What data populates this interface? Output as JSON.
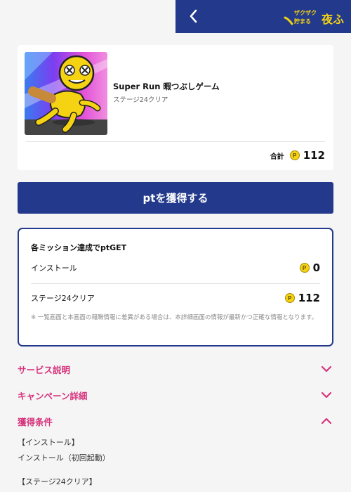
{
  "header": {
    "back_icon": "chevron-left-icon",
    "logo_text": "ザクザク貯まる 夜ふ",
    "bg_color": "#233a8c"
  },
  "game": {
    "title": "Super Run 暇つぶしゲーム",
    "subtitle": "ステージ24クリア",
    "total_label": "合計",
    "coin_symbol": "P",
    "total_value": "112"
  },
  "get_button": {
    "label": "ptを獲得する"
  },
  "missions": {
    "title": "各ミッション達成でptGET",
    "items": [
      {
        "label": "インストール",
        "value": "0"
      },
      {
        "label": "ステージ24クリア",
        "value": "112"
      }
    ],
    "note": "※ 一覧画面と本画面の報酬情報に差異がある場合は、本詳細画面の情報が最新かつ正確な情報となります。"
  },
  "accordions": [
    {
      "title": "サービス説明",
      "state": "collapsed"
    },
    {
      "title": "キャンペーン詳細",
      "state": "collapsed"
    },
    {
      "title": "獲得条件",
      "state": "expanded"
    }
  ],
  "conditions": {
    "lines": [
      "【インストール】",
      "インストール（初回起動）",
      "【ステージ24クリア】"
    ]
  },
  "colors": {
    "brand": "#233a8c",
    "accent": "#d6337c",
    "coin": "#f5d312"
  }
}
